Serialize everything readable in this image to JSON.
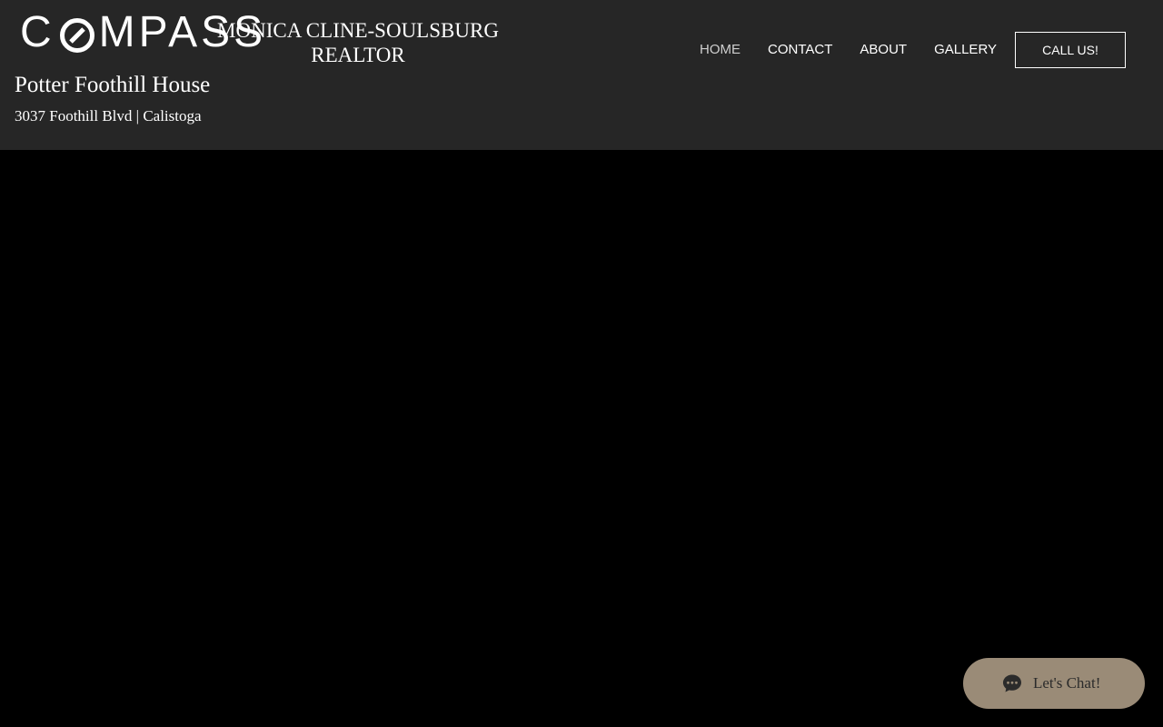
{
  "brand": {
    "logo_pre": "C",
    "logo_post": "MPASS",
    "agent_name": "MONICA CLINE-SOULSBURG REALTOR"
  },
  "property": {
    "title": "Potter Foothill House",
    "address": "3037 Foothill Blvd | Calistoga"
  },
  "nav": {
    "items": [
      {
        "label": "HOME",
        "active": true
      },
      {
        "label": "CONTACT",
        "active": false
      },
      {
        "label": "ABOUT",
        "active": false
      },
      {
        "label": "GALLERY",
        "active": false
      }
    ],
    "cta_label": "CALL US!"
  },
  "chat": {
    "label": "Let's Chat!",
    "icon": "chat-bubble-icon"
  },
  "colors": {
    "header_bg": "#262626",
    "page_bg": "#000000",
    "chat_bg": "#9a8b77",
    "text": "#ffffff"
  }
}
